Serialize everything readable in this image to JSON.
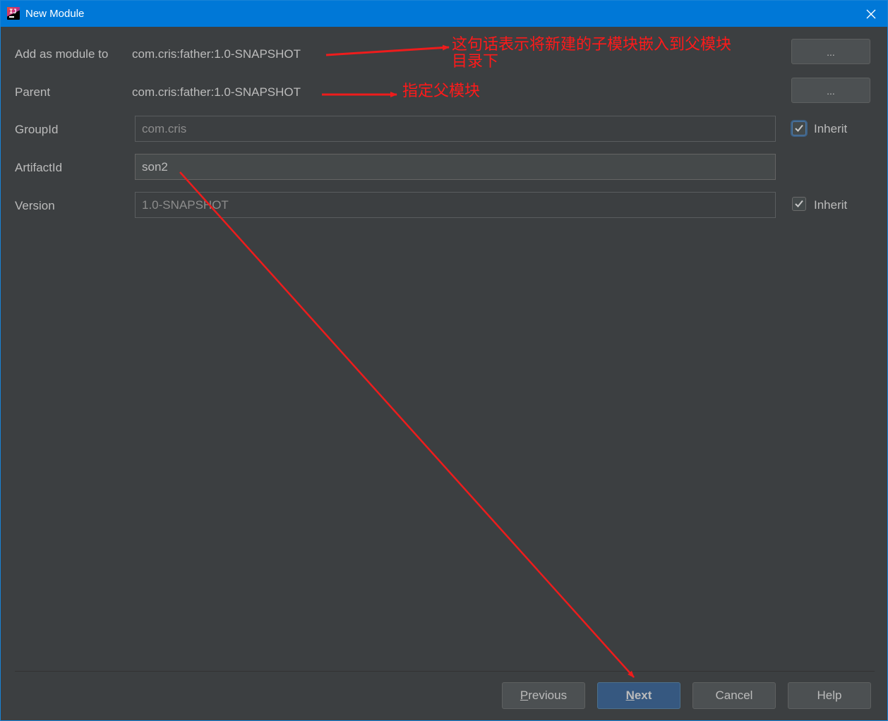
{
  "window": {
    "title": "New Module",
    "app_icon_text": "IJ",
    "close_icon": "close-icon"
  },
  "form": {
    "add_as_module_label": "Add as module to",
    "add_as_module_value": "com.cris:father:1.0-SNAPSHOT",
    "parent_label": "Parent",
    "parent_value": "com.cris:father:1.0-SNAPSHOT",
    "browse_button_label": "...",
    "groupid_label": "GroupId",
    "groupid_value": "com.cris",
    "artifactid_label": "ArtifactId",
    "artifactid_value": "son2",
    "version_label": "Version",
    "version_value": "1.0-SNAPSHOT",
    "inherit_label": "Inherit",
    "groupid_inherit_checked": true,
    "version_inherit_checked": true
  },
  "buttons": {
    "previous_mnemonic": "P",
    "previous_rest": "revious",
    "next_mnemonic": "N",
    "next_rest": "ext",
    "cancel": "Cancel",
    "help": "Help"
  },
  "annotations": {
    "module_note_line1": "这句话表示将新建的子模块嵌入到父模块",
    "module_note_line2": "目录下",
    "parent_note": "指定父模块"
  },
  "colors": {
    "titlebar": "#0078d7",
    "background": "#3c3f41",
    "annotation": "#ff1a1a",
    "primary_button": "#365880"
  }
}
